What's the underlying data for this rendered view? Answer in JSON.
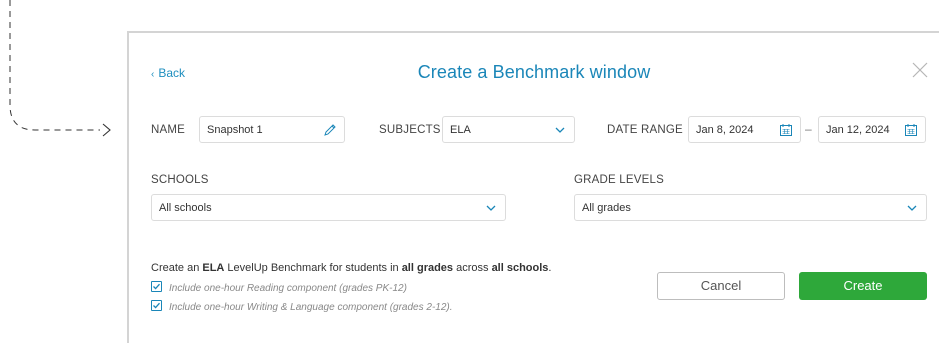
{
  "dialog": {
    "back_label": "Back",
    "title": "Create a Benchmark window"
  },
  "form": {
    "name_label": "NAME",
    "name_value": "Snapshot 1",
    "subjects_label": "SUBJECTS",
    "subjects_value": "ELA",
    "date_range_label": "DATE RANGE",
    "date_start": "Jan 8, 2024",
    "date_separator": "–",
    "date_end": "Jan 12, 2024",
    "schools_label": "SCHOOLS",
    "schools_value": "All schools",
    "grade_levels_label": "GRADE LEVELS",
    "grade_levels_value": "All grades"
  },
  "summary": {
    "prefix": "Create an ",
    "subject": "ELA",
    "middle": " LevelUp Benchmark for students in ",
    "grades": "all grades",
    "across": " across ",
    "schools": "all schools",
    "suffix": "."
  },
  "checkboxes": [
    {
      "label": "Include one-hour Reading component (grades PK-12)",
      "checked": true
    },
    {
      "label": "Include one-hour Writing & Language component (grades 2-12).",
      "checked": true
    }
  ],
  "actions": {
    "cancel_label": "Cancel",
    "create_label": "Create"
  },
  "colors": {
    "accent": "#1a86b8",
    "create_button": "#2ea83a"
  }
}
